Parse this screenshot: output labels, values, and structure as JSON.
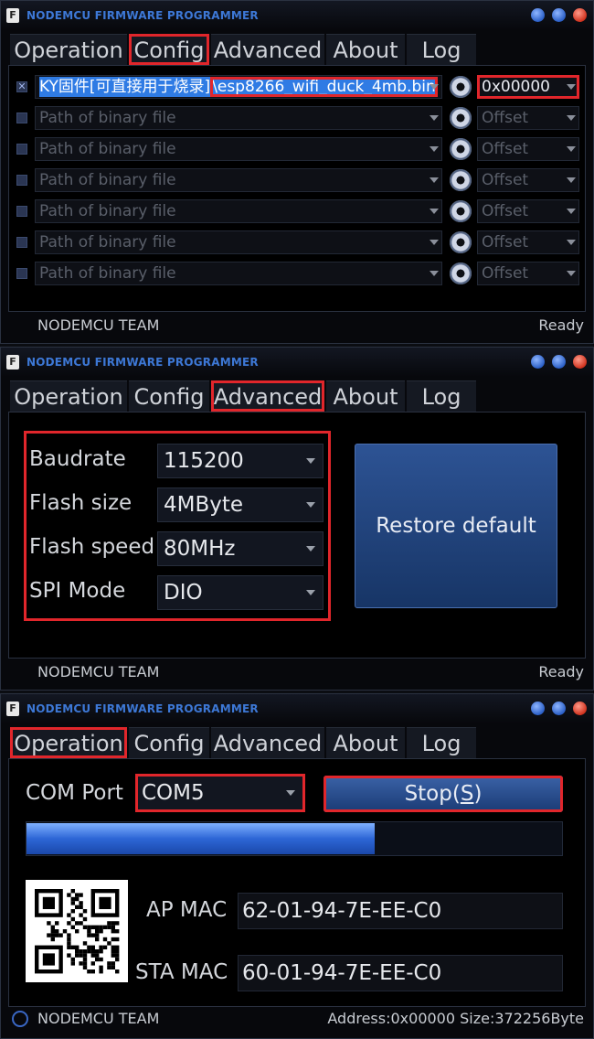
{
  "app": {
    "title": "NODEMCU FIRMWARE PROGRAMMER",
    "team": "NODEMCU TEAM",
    "tabs": [
      "Operation",
      "Config",
      "Advanced",
      "About",
      "Log"
    ]
  },
  "config_window": {
    "highlighted_tab": "Config",
    "status": "Ready",
    "rows": [
      {
        "checked": true,
        "path_part1": "KY固件[可直接用于烧录]",
        "path_part2": "\\esp8266_wifi_duck_4mb.bin",
        "offset": "0x00000"
      },
      {
        "checked": false,
        "path_placeholder": "Path of binary file",
        "offset_placeholder": "Offset"
      },
      {
        "checked": false,
        "path_placeholder": "Path of binary file",
        "offset_placeholder": "Offset"
      },
      {
        "checked": false,
        "path_placeholder": "Path of binary file",
        "offset_placeholder": "Offset"
      },
      {
        "checked": false,
        "path_placeholder": "Path of binary file",
        "offset_placeholder": "Offset"
      },
      {
        "checked": false,
        "path_placeholder": "Path of binary file",
        "offset_placeholder": "Offset"
      },
      {
        "checked": false,
        "path_placeholder": "Path of binary file",
        "offset_placeholder": "Offset"
      }
    ]
  },
  "advanced_window": {
    "highlighted_tab": "Advanced",
    "status": "Ready",
    "settings": [
      {
        "label": "Baudrate",
        "value": "115200"
      },
      {
        "label": "Flash size",
        "value": "4MByte"
      },
      {
        "label": "Flash speed",
        "value": "80MHz"
      },
      {
        "label": "SPI Mode",
        "value": "DIO"
      }
    ],
    "restore_button": "Restore default"
  },
  "operation_window": {
    "highlighted_tab": "Operation",
    "com_port_label": "COM Port",
    "com_port_value": "COM5",
    "stop_button_prefix": "Stop(",
    "stop_button_key": "S",
    "stop_button_suffix": ")",
    "progress_fraction": 0.65,
    "ap_mac_label": "AP MAC",
    "ap_mac": "62-01-94-7E-EE-C0",
    "sta_mac_label": "STA MAC",
    "sta_mac": "60-01-94-7E-EE-C0",
    "address": "Address:0x00000",
    "size": "Size:372256Byte"
  },
  "colors": {
    "highlight_red": "#e1262b",
    "accent_blue": "#2f7be4",
    "title_blue": "#3d78d6"
  }
}
